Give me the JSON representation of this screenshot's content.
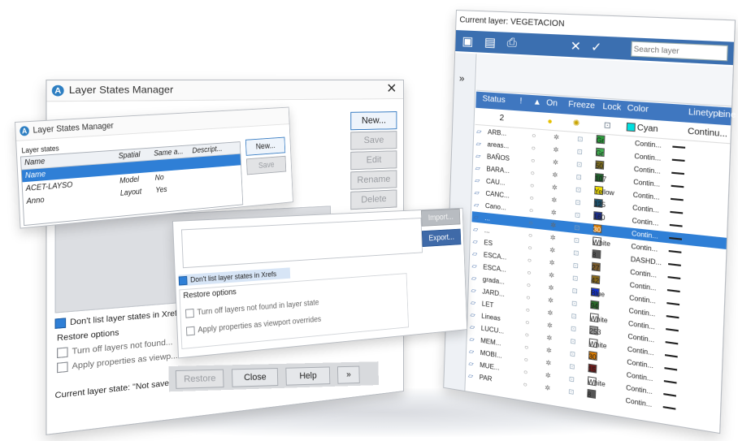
{
  "layer_manager": {
    "current_layer": "Current layer: VEGETACION",
    "search_placeholder": "Search layer",
    "toolbar_icons": [
      "new-layer-icon",
      "new-vp-layer-icon",
      "layer-states-icon",
      "delete-layer-icon",
      "set-current-icon"
    ],
    "columns": [
      "Status",
      "!",
      "▲",
      "On",
      "Freeze",
      "Lock",
      "Color",
      "Linetype",
      "Line"
    ],
    "row0": {
      "name": "0",
      "index": "2",
      "color": "Cyan",
      "linetype": "Continu..."
    },
    "layers": [
      {
        "name": "ARB...",
        "color_name": "Gr",
        "color": "#2a9d3a",
        "lt": "Contin..."
      },
      {
        "name": "areas...",
        "color_name": "Gr",
        "color": "#3fae4f",
        "lt": "Contin..."
      },
      {
        "name": "BAÑOS",
        "color_name": "50",
        "color": "#7a6a1e",
        "lt": "Contin..."
      },
      {
        "name": "BARA...",
        "color_name": "107",
        "color": "#1f5f2a",
        "lt": "Contin..."
      },
      {
        "name": "CAU...",
        "color_name": "Yellow",
        "color": "#f3e000",
        "lt": "Contin..."
      },
      {
        "name": "CANC...",
        "color_name": "125",
        "color": "#1c4f6a",
        "lt": "Contin..."
      },
      {
        "name": "Cano...",
        "color_name": "160",
        "color": "#1c2f8a",
        "lt": "Contin..."
      },
      {
        "name": "...",
        "color_name": "30",
        "color": "#d97a00",
        "lt": "Contin..."
      },
      {
        "name": "...",
        "color_name": "White",
        "color": "#ffffff",
        "lt": "Contin..."
      },
      {
        "name": "ES",
        "color_name": "8",
        "color": "#555555",
        "lt": "DASHD..."
      },
      {
        "name": "ESCA...",
        "color_name": "27",
        "color": "#7a5a2a",
        "lt": "Contin..."
      },
      {
        "name": "ESCA...",
        "color_name": "42",
        "color": "#8a6a1a",
        "lt": "Contin..."
      },
      {
        "name": "grada...",
        "color_name": "Blue",
        "color": "#1030d0",
        "lt": "Contin..."
      },
      {
        "name": "JARD...",
        "color_name": "94",
        "color": "#2a6a2a",
        "lt": "Contin..."
      },
      {
        "name": "LET",
        "color_name": "White",
        "color": "#ffffff",
        "lt": "Contin..."
      },
      {
        "name": "Lineas",
        "color_name": "253",
        "color": "#9a9a9a",
        "lt": "Contin..."
      },
      {
        "name": "LUCU...",
        "color_name": "White",
        "color": "#ffffff",
        "lt": "Contin..."
      },
      {
        "name": "MEM...",
        "color_name": "30",
        "color": "#d97a00",
        "lt": "Contin..."
      },
      {
        "name": "MOBI...",
        "color_name": "15",
        "color": "#6a1a1a",
        "lt": "Contin..."
      },
      {
        "name": "MUE...",
        "color_name": "White",
        "color": "#ffffff",
        "lt": "Contin..."
      },
      {
        "name": "PAR",
        "color_name": "8",
        "color": "#555555",
        "lt": "Contin..."
      }
    ]
  },
  "lsm_back": {
    "title": "Layer States Manager",
    "buttons": [
      "New...",
      "Save",
      "Edit",
      "Rename",
      "Delete"
    ],
    "dont_list": "Don't list layer states in Xrefs",
    "restore_options": "Restore options",
    "turn_off": "Turn off layers not found...",
    "apply_props": "Apply properties as viewp...",
    "current_state": "Current layer state: \"Not saved\""
  },
  "lsm_front": {
    "title": "Layer States Manager",
    "layer_states_label": "Layer states",
    "columns": [
      "Name",
      "Spatial",
      "Same a...",
      "Descript..."
    ],
    "rows": [
      {
        "name": "Name",
        "spatial": "",
        "same": "",
        "desc": ""
      },
      {
        "name": "ACET-LAYSO",
        "spatial": "Model",
        "same": "No",
        "desc": ""
      },
      {
        "name": "Anno",
        "spatial": "Layout",
        "same": "Yes",
        "desc": ""
      }
    ],
    "new_button": "New...",
    "save_button": "Save"
  },
  "lsm_mid": {
    "import_button": "Import...",
    "export_button": "Export...",
    "dont_list": "Don't list layer states in Xrefs",
    "restore_options": "Restore options",
    "turn_off": "Turn off layers not found in layer state",
    "apply_props": "Apply properties as viewport overrides",
    "restore_button": "Restore",
    "close_button": "Close",
    "help_button": "Help",
    "expand": "»"
  }
}
